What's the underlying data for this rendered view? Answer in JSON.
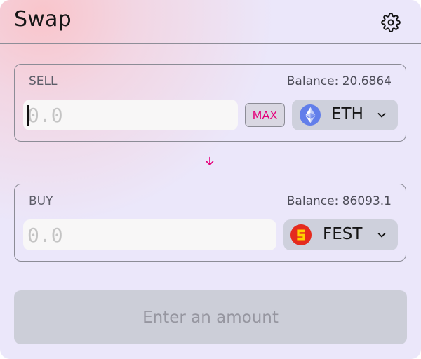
{
  "header": {
    "title": "Swap"
  },
  "sell": {
    "label": "SELL",
    "balance": "Balance: 20.6864",
    "amount_placeholder": "0.0",
    "max_label": "MAX",
    "token": {
      "symbol": "ETH",
      "icon": "eth-icon"
    }
  },
  "buy": {
    "label": "BUY",
    "balance": "Balance: 86093.1",
    "amount_placeholder": "0.0",
    "token": {
      "symbol": "FEST",
      "icon": "fest-token-icon"
    }
  },
  "action": {
    "label": "Enter an amount"
  },
  "colors": {
    "accent": "#e4007a",
    "eth": "#627eea",
    "fest_red": "#e52b1e",
    "fest_yellow": "#ffd200"
  }
}
